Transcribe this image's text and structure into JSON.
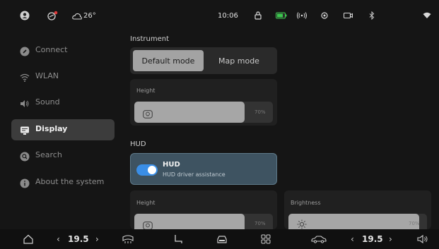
{
  "status_bar": {
    "outside_temp": "26°",
    "time": "10:06",
    "icons": [
      "user-avatar-icon",
      "car-alert-icon",
      "cloud-icon",
      "lock-icon",
      "battery-icon",
      "broadcast-icon",
      "location-icon",
      "camera-icon",
      "bluetooth-icon",
      "wifi-icon"
    ],
    "battery_color": "#3cc94f"
  },
  "sidebar": {
    "items": [
      {
        "label": "Connect",
        "icon": "link-icon",
        "active": false
      },
      {
        "label": "WLAN",
        "icon": "wifi-icon",
        "active": false
      },
      {
        "label": "Sound",
        "icon": "speaker-icon",
        "active": false
      },
      {
        "label": "Display",
        "icon": "display-icon",
        "active": true
      },
      {
        "label": "Search",
        "icon": "search-icon",
        "active": false
      },
      {
        "label": "About the system",
        "icon": "info-icon",
        "active": false
      }
    ]
  },
  "main": {
    "instrument": {
      "title": "Instrument",
      "modes": [
        "Default mode",
        "Map mode"
      ],
      "selected_mode": "Default mode",
      "height_label": "Height",
      "height_value": "70%",
      "height_level": 0.7
    },
    "hud": {
      "title": "HUD",
      "toggle_title": "HUD",
      "toggle_subtitle": "HUD driver assistance",
      "toggle_on": true,
      "height_label": "Height",
      "height_value": "70%",
      "brightness_label": "Brightness",
      "brightness_value": "70%"
    }
  },
  "dock": {
    "left_temp": "19.5",
    "right_temp": "19.5",
    "icons": [
      "home-icon",
      "fan-icon",
      "seat-icon",
      "car-front-icon",
      "apps-grid-icon",
      "car-side-icon",
      "volume-icon"
    ]
  },
  "colors": {
    "accent_toggle": "#3a8ee6",
    "hud_card_bg": "#3e5361"
  }
}
